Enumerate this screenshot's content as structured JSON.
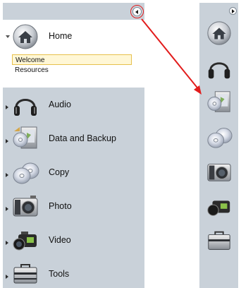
{
  "panel": {
    "categories": [
      {
        "label": "Home",
        "icon": "home-icon"
      },
      {
        "label": "Audio",
        "icon": "headphones-icon"
      },
      {
        "label": "Data and Backup",
        "icon": "data-backup-icon"
      },
      {
        "label": "Copy",
        "icon": "copy-discs-icon"
      },
      {
        "label": "Photo",
        "icon": "camera-icon"
      },
      {
        "label": "Video",
        "icon": "video-camera-icon"
      },
      {
        "label": "Tools",
        "icon": "toolbox-icon"
      }
    ],
    "home_subitems": [
      {
        "label": "Welcome",
        "selected": true
      },
      {
        "label": "Resources",
        "selected": false
      }
    ]
  },
  "colors": {
    "panel_bg": "#c9d1d9",
    "selection_bg": "#fff7d6",
    "selection_border": "#e7c04d",
    "callout": "#e21c1c"
  }
}
